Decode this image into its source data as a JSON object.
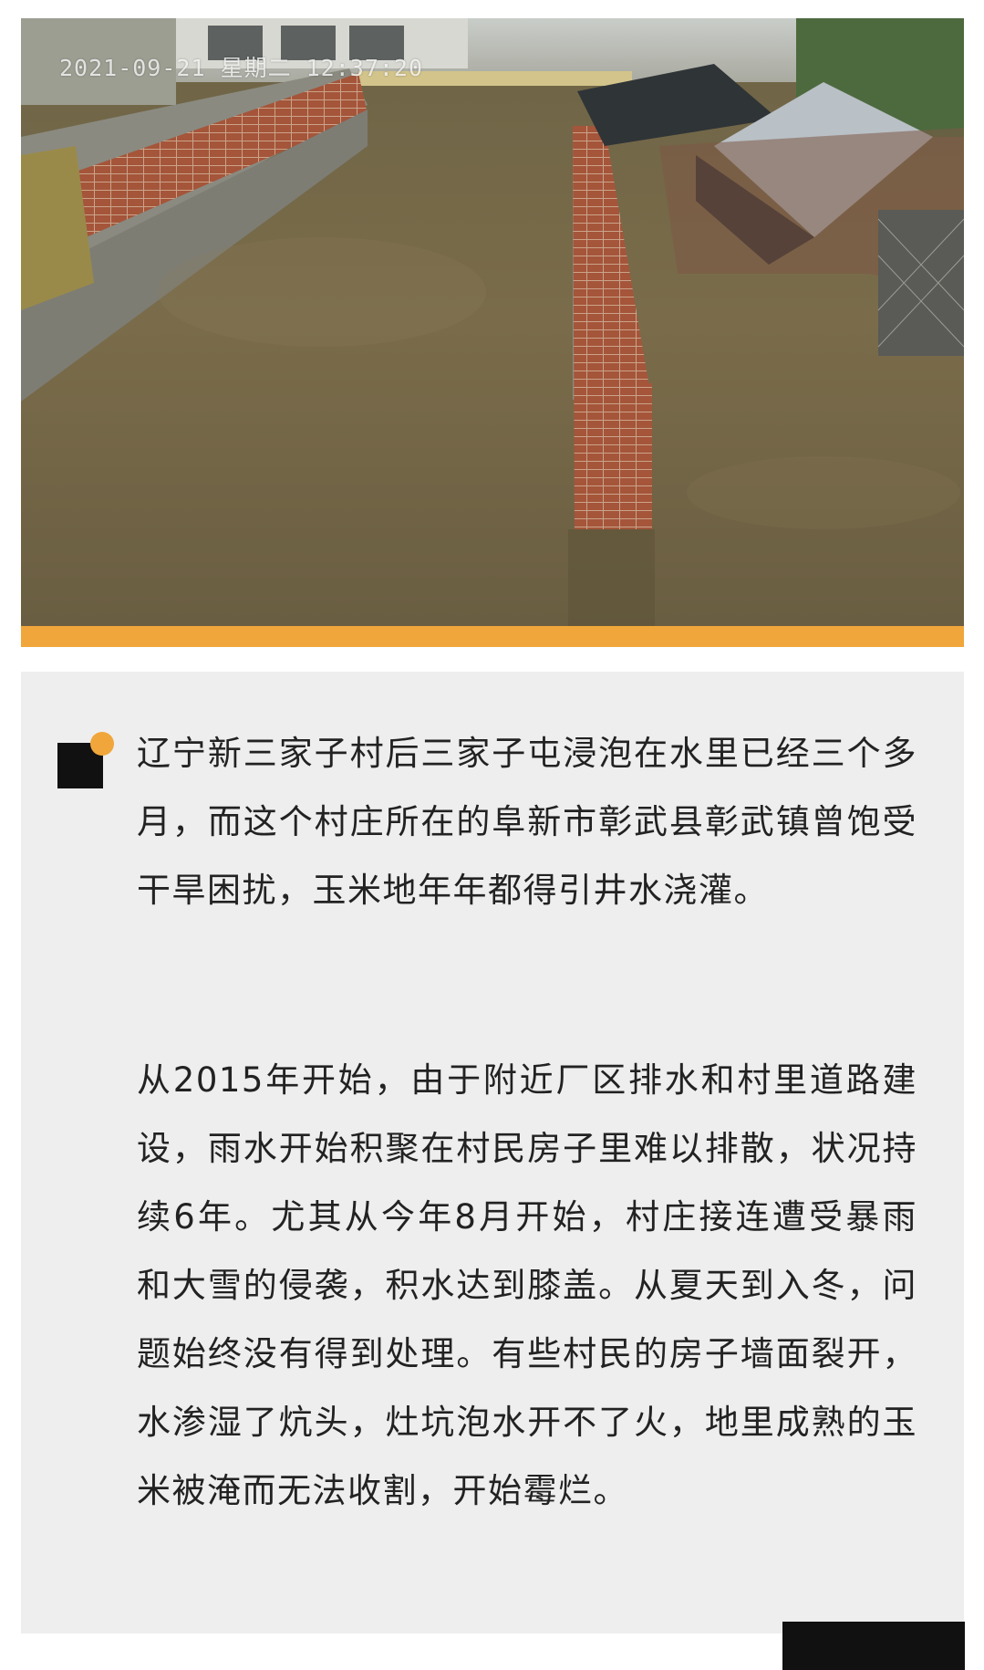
{
  "photo": {
    "timestamp": "2021-09-21 星期二 12:37:20"
  },
  "colors": {
    "accent": "#f0a63a",
    "card_background": "#eeeeee",
    "text": "#222222"
  },
  "article": {
    "paragraphs": [
      "辽宁新三家子村后三家子屯浸泡在水里已经三个多月，而这个村庄所在的阜新市彰武县彰武镇曾饱受干旱困扰，玉米地年年都得引井水浇灌。",
      "从2015年开始，由于附近厂区排水和村里道路建设，雨水开始积聚在村民房子里难以排散，状况持续6年。尤其从今年8月开始，村庄接连遭受暴雨和大雪的侵袭，积水达到膝盖。从夏天到入冬，问题始终没有得到处理。有些村民的房子墙面裂开，水渗湿了炕头，灶坑泡水开不了火，地里成熟的玉米被淹而无法收割，开始霉烂。"
    ]
  }
}
